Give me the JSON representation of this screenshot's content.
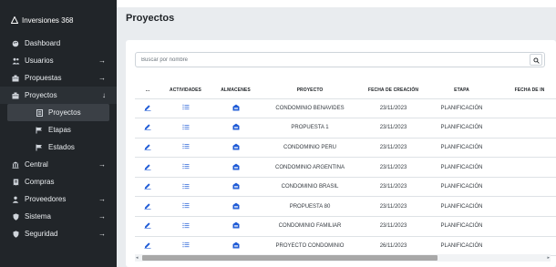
{
  "brand": {
    "name": "Inversiones 368",
    "icon": "brand-icon"
  },
  "sidebar": {
    "items": [
      {
        "label": "Dashboard",
        "icon": "palette-icon",
        "arrow": ""
      },
      {
        "label": "Usuarios",
        "icon": "users-icon",
        "arrow": "→"
      },
      {
        "label": "Propuestas",
        "icon": "building-icon",
        "arrow": "→"
      },
      {
        "label": "Proyectos",
        "icon": "building-icon",
        "arrow": "↓"
      }
    ],
    "subitems": [
      {
        "label": "Proyectos",
        "icon": "list-icon"
      },
      {
        "label": "Etapas",
        "icon": "flag-icon"
      },
      {
        "label": "Estados",
        "icon": "flag-icon"
      }
    ],
    "items_after": [
      {
        "label": "Central",
        "icon": "bank-icon",
        "arrow": "→"
      },
      {
        "label": "Compras",
        "icon": "receipt-icon",
        "arrow": "→"
      },
      {
        "label": "Proveedores",
        "icon": "user-icon",
        "arrow": "→"
      },
      {
        "label": "Sistema",
        "icon": "shield-icon",
        "arrow": "→"
      },
      {
        "label": "Seguridad",
        "icon": "shield-icon",
        "arrow": "→"
      }
    ]
  },
  "page": {
    "title": "Proyectos"
  },
  "search": {
    "placeholder": "Buscar por nombre"
  },
  "table": {
    "headers": [
      "...",
      "ACTIVIDADES",
      "ALMACENES",
      "PROYECTO",
      "FECHA DE CREACIÓN",
      "ETAPA",
      "FECHA DE IN"
    ],
    "rows": [
      {
        "proyecto": "CONDOMINIO BENAVIDES",
        "fecha": "23/11/2023",
        "etapa": "PLANIFICACIÓN"
      },
      {
        "proyecto": "PROPUESTA 1",
        "fecha": "23/11/2023",
        "etapa": "PLANIFICACIÓN"
      },
      {
        "proyecto": "CONDOMINIO PERU",
        "fecha": "23/11/2023",
        "etapa": "PLANIFICACIÓN"
      },
      {
        "proyecto": "CONDOMINIO ARGENTINA",
        "fecha": "23/11/2023",
        "etapa": "PLANIFICACIÓN"
      },
      {
        "proyecto": "CONDOMINIO BRASIL",
        "fecha": "23/11/2023",
        "etapa": "PLANIFICACIÓN"
      },
      {
        "proyecto": "PROPUESTA 80",
        "fecha": "23/11/2023",
        "etapa": "PLANIFICACIÓN"
      },
      {
        "proyecto": "CONDOMINIO FAMILIAR",
        "fecha": "23/11/2023",
        "etapa": "PLANIFICACIÓN"
      },
      {
        "proyecto": "PROYECTO CONDOMINIO",
        "fecha": "26/11/2023",
        "etapa": "PLANIFICACIÓN"
      }
    ]
  },
  "colors": {
    "sidebar_bg": "#212529",
    "accent": "#1f5bd6",
    "page_bg": "#e9ecef"
  }
}
